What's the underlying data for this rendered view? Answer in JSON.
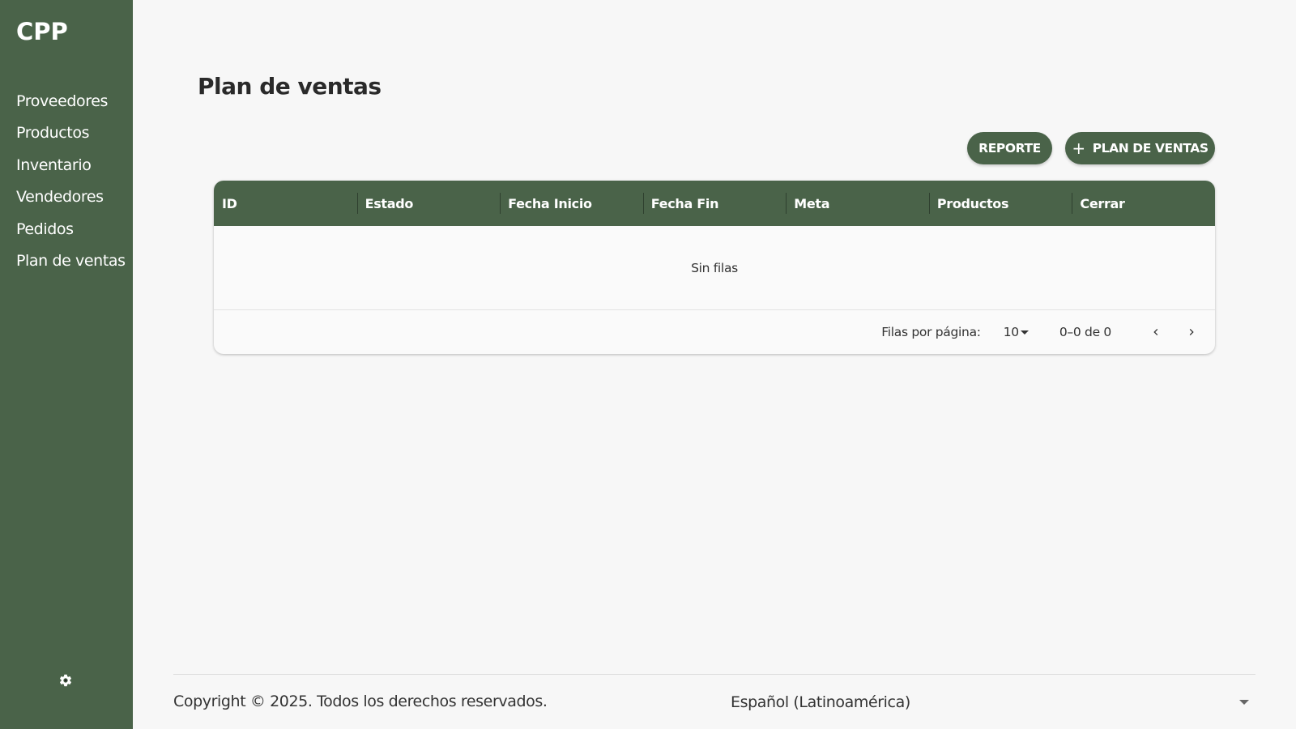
{
  "app": {
    "logo": "CPP"
  },
  "sidebar": {
    "items": [
      {
        "label": "Proveedores"
      },
      {
        "label": "Productos"
      },
      {
        "label": "Inventario"
      },
      {
        "label": "Vendedores"
      },
      {
        "label": "Pedidos"
      },
      {
        "label": "Plan de ventas"
      }
    ],
    "settings_icon": "gear-icon"
  },
  "page": {
    "title": "Plan de ventas"
  },
  "actions": {
    "report_label": "REPORTE",
    "add_label": "PLAN DE VENTAS",
    "add_icon": "plus-icon"
  },
  "table": {
    "columns": [
      "ID",
      "Estado",
      "Fecha Inicio",
      "Fecha Fin",
      "Meta",
      "Productos",
      "Cerrar"
    ],
    "empty_message": "Sin filas",
    "pagination": {
      "rows_per_page_label": "Filas por página:",
      "rows_per_page_value": "10",
      "range": "0–0 de 0"
    }
  },
  "footer": {
    "copyright": "Copyright © 2025. Todos los derechos reservados.",
    "language": "Español (Latinoamérica)"
  },
  "colors": {
    "primary": "#4a6349",
    "background": "#f7f7f7"
  }
}
